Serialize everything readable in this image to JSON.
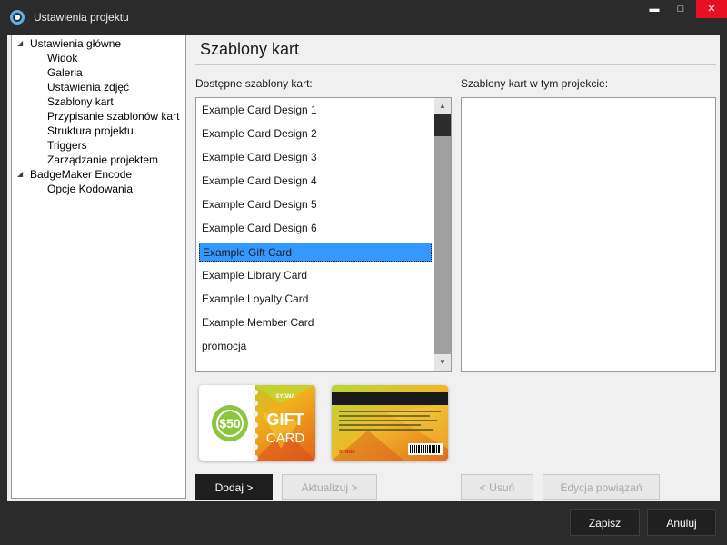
{
  "window": {
    "title": "Ustawienia projektu",
    "minimize_glyph": "▬",
    "maximize_glyph": "□",
    "close_glyph": "✕"
  },
  "tree": {
    "groups": [
      {
        "label": "Ustawienia główne",
        "expanded": true,
        "children": [
          "Widok",
          "Galeria",
          "Ustawienia zdjęć",
          "Szablony kart",
          "Przypisanie szablonów kart",
          "Struktura projektu",
          "Triggers",
          "Zarządzanie projektem"
        ]
      },
      {
        "label": "BadgeMaker Encode",
        "expanded": true,
        "children": [
          "Opcje Kodowania"
        ]
      }
    ]
  },
  "main": {
    "title": "Szablony kart",
    "available_label": "Dostępne szablony kart:",
    "project_label": "Szablony kart w tym projekcie:",
    "available_templates": [
      "Example Card Design 1",
      "Example Card Design 2",
      "Example Card Design 3",
      "Example Card Design 4",
      "Example Card Design 5",
      "Example Card Design 6",
      "Example Gift Card",
      "Example Library Card",
      "Example Loyalty Card",
      "Example Member Card",
      "promocja"
    ],
    "selected_template": "Example Gift Card",
    "project_templates": [],
    "preview_front": {
      "amount": "$50",
      "word1": "GIFT",
      "word2": "CARD",
      "brand": "SYGNA"
    },
    "preview_back": {
      "brand": "SYGNA"
    },
    "buttons": {
      "add": "Dodaj >",
      "update": "Aktualizuj >",
      "remove": "< Usuń",
      "edit_links": "Edycja powiązań"
    }
  },
  "footer": {
    "save": "Zapisz",
    "cancel": "Anuluj"
  },
  "colors": {
    "selection": "#3399ff",
    "close_button": "#e81123",
    "chrome": "#2b2b2b",
    "primary_button": "#1e1e1e"
  }
}
